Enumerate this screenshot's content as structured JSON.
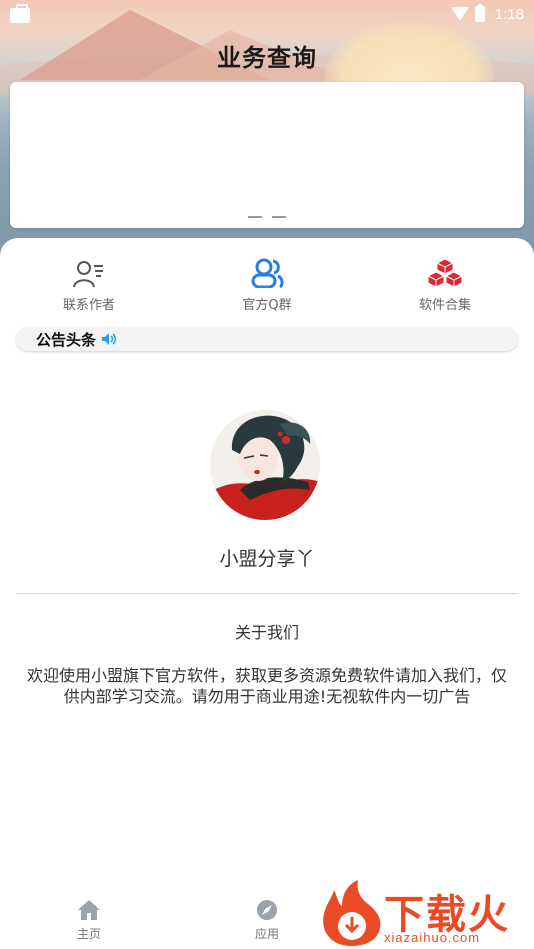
{
  "status_bar": {
    "time": "1:18"
  },
  "header": {
    "title": "业务查询"
  },
  "quick_nav": [
    {
      "label": "联系作者",
      "icon": "person-list-icon"
    },
    {
      "label": "官方Q群",
      "icon": "group-icon"
    },
    {
      "label": "软件合集",
      "icon": "boxes-icon"
    }
  ],
  "notice": {
    "label": "公告头条",
    "icon": "speaker-icon"
  },
  "profile": {
    "name": "小盟分享丫"
  },
  "about": {
    "title": "关于我们",
    "text": "欢迎使用小盟旗下官方软件，获取更多资源免费软件请加入我们，仅供内部学习交流。请勿用于商业用途!无视软件内一切广告"
  },
  "bottom_nav": [
    {
      "label": "主页",
      "icon": "home-icon"
    },
    {
      "label": "应用",
      "icon": "compass-icon"
    }
  ],
  "watermark": {
    "brand": "下载火",
    "url": "xiazaihuo.com"
  },
  "colors": {
    "accent_blue": "#2a7de1",
    "accent_red": "#e5262c",
    "watermark": "#ea4b26"
  }
}
